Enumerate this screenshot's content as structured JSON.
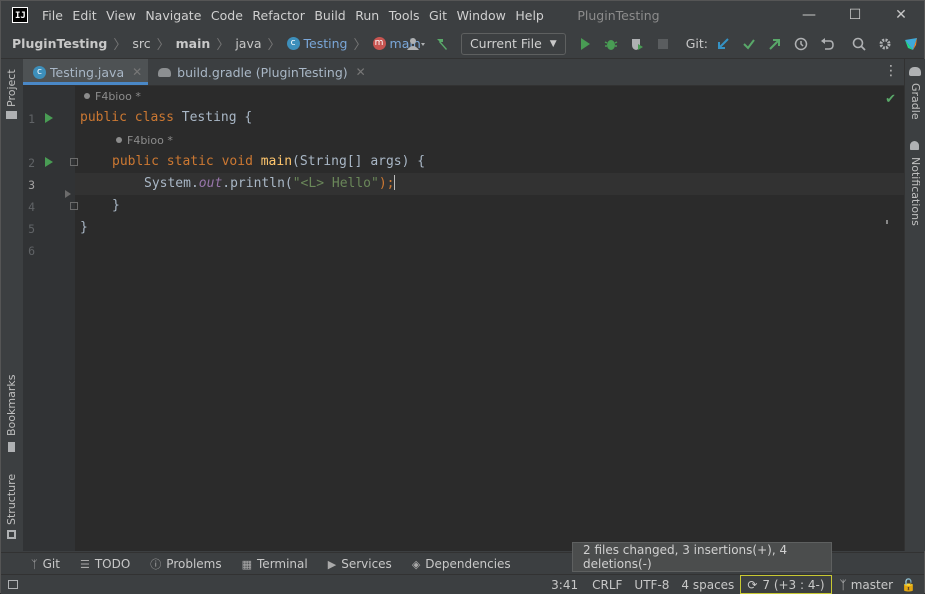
{
  "menu": [
    "File",
    "Edit",
    "View",
    "Navigate",
    "Code",
    "Refactor",
    "Build",
    "Run",
    "Tools",
    "Git",
    "Window",
    "Help"
  ],
  "window_title": "PluginTesting",
  "breadcrumbs": {
    "project": "PluginTesting",
    "src": "src",
    "main": "main",
    "java": "java",
    "class": "Testing",
    "method": "main"
  },
  "toolbar": {
    "run_config": "Current File",
    "git_label": "Git:"
  },
  "tabs": [
    {
      "label": "Testing.java",
      "active": true
    },
    {
      "label": "build.gradle (PluginTesting)",
      "active": false
    }
  ],
  "side_tools": {
    "left_top": "Project",
    "left_mid": "Bookmarks",
    "left_bottom": "Structure",
    "right_top": "Gradle",
    "right_mid": "Notifications"
  },
  "editor": {
    "line_numbers": [
      "1",
      "2",
      "3",
      "4",
      "5",
      "6"
    ],
    "authors": [
      "F4bioo *",
      "F4bioo *"
    ],
    "code": {
      "l1": {
        "kw1": "public",
        "kw2": "class",
        "name": "Testing",
        "brace": "{"
      },
      "l2": {
        "kw1": "public",
        "kw2": "static",
        "kw3": "void",
        "fn": "main",
        "params": "(String[] args) {"
      },
      "l3": {
        "obj": "System.",
        "field": "out",
        "call": ".println(",
        "str": "\"<L> Hello\"",
        "end": ");"
      },
      "l4": "}",
      "l5": "}"
    }
  },
  "bottom_tools": [
    "Git",
    "TODO",
    "Problems",
    "Terminal",
    "Services",
    "Dependencies"
  ],
  "status": {
    "position": "3:41",
    "line_sep": "CRLF",
    "encoding": "UTF-8",
    "indent": "4 spaces",
    "git_changes": "7 (+3 : 4-)",
    "branch": "master"
  },
  "tooltip": "2 files changed, 3 insertions(+), 4 deletions(-)",
  "colors": {
    "accent": "#4a88c7",
    "run_green": "#499c54",
    "highlight_border": "#c8c832"
  }
}
